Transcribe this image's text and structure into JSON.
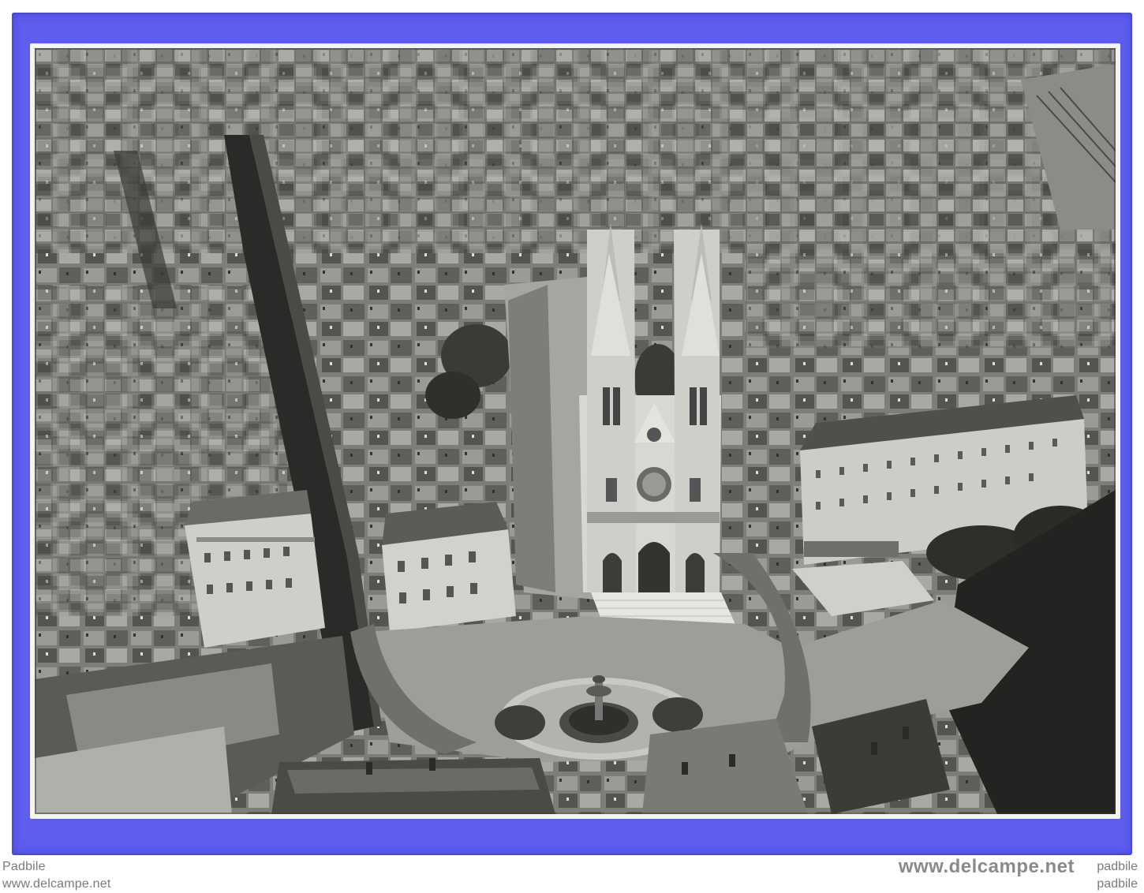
{
  "watermark": {
    "top_left_user": "Padbile",
    "bottom_left_url": "www.delcampe.net",
    "logo_text": "www.delcampe.net",
    "top_right_user": "padbile",
    "bottom_right_user": "padbile"
  },
  "colors": {
    "frame_blue": "#5f5cf0",
    "card_border": "#f4f4f1",
    "watermark_gray": "#7a7a7a"
  }
}
